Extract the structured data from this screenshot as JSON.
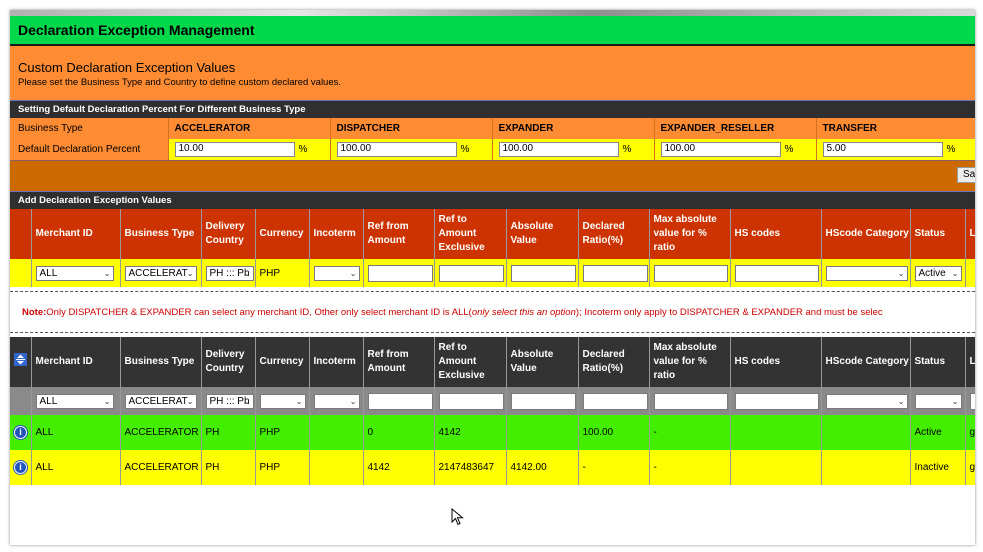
{
  "page": {
    "title": "Declaration Exception Management",
    "heading": "Custom Declaration Exception Values",
    "subheading": "Please set the Business Type and Country to define custom declared values."
  },
  "defaults_section": {
    "title": "Setting Default Declaration Percent For Different Business Type",
    "row1_label": "Business Type",
    "row2_label": "Default Declaration Percent",
    "percent_sign": "%",
    "types": [
      {
        "name": "ACCELERATOR",
        "value": "10.00"
      },
      {
        "name": "DISPATCHER",
        "value": "100.00"
      },
      {
        "name": "EXPANDER",
        "value": "100.00"
      },
      {
        "name": "EXPANDER_RESELLER",
        "value": "100.00"
      },
      {
        "name": "TRANSFER",
        "value": "5.00"
      }
    ],
    "save_label": "Sa"
  },
  "add_section": {
    "title": "Add Declaration Exception Values",
    "columns": [
      "Merchant ID",
      "Business Type",
      "Delivery Country",
      "Currency",
      "Incoterm",
      "Ref from Amount",
      "Ref to Amount Exclusive",
      "Absolute Value",
      "Declared Ratio(%)",
      "Max absolute value for % ratio",
      "HS codes",
      "HScode Category",
      "Status",
      "L"
    ],
    "form": {
      "merchant": "ALL",
      "business_type": "ACCELERAT",
      "country": "PH ::: Ph",
      "currency": "PHP",
      "status": "Active"
    }
  },
  "note": {
    "prefix": "Note:",
    "text1": " Only DISPATCHER & EXPANDER can select any merchant ID, Other only select merchant ID is ALL(",
    "italic": "only select this an option",
    "text2": "); Incoterm only apply to DISPATCHER & EXPANDER and must be selec"
  },
  "list_section": {
    "columns": [
      "Merchant ID",
      "Business Type",
      "Delivery Country",
      "Currency",
      "Incoterm",
      "Ref from Amount",
      "Ref to Amount Exclusive",
      "Absolute Value",
      "Declared Ratio(%)",
      "Max absolute value for % ratio",
      "HS codes",
      "HScode Category",
      "Status",
      "L"
    ],
    "filters": {
      "merchant": "ALL",
      "business_type": "ACCELERAT",
      "country": "PH ::: Ph"
    },
    "rows": [
      {
        "merchant": "ALL",
        "business_type": "ACCELERATOR",
        "country": "PH",
        "currency": "PHP",
        "incoterm": "",
        "ref_from": "0",
        "ref_to": "4142",
        "absolute": "",
        "ratio": "100.00",
        "max_abs": "-",
        "hs": "",
        "hs_cat": "",
        "status": "Active",
        "last": "g"
      },
      {
        "merchant": "ALL",
        "business_type": "ACCELERATOR",
        "country": "PH",
        "currency": "PHP",
        "incoterm": "",
        "ref_from": "4142",
        "ref_to": "2147483647",
        "absolute": "4142.00",
        "ratio": "-",
        "max_abs": "-",
        "hs": "",
        "hs_cat": "",
        "status": "Inactive",
        "last": "g"
      }
    ]
  },
  "icons": {
    "info": "i",
    "chevron": "⌄"
  },
  "colors": {
    "title_green": "#00d84c",
    "orange": "#ff8c33",
    "red_header": "#cc3300",
    "active_row": "#44ee00",
    "inactive_row": "#ffff00"
  }
}
